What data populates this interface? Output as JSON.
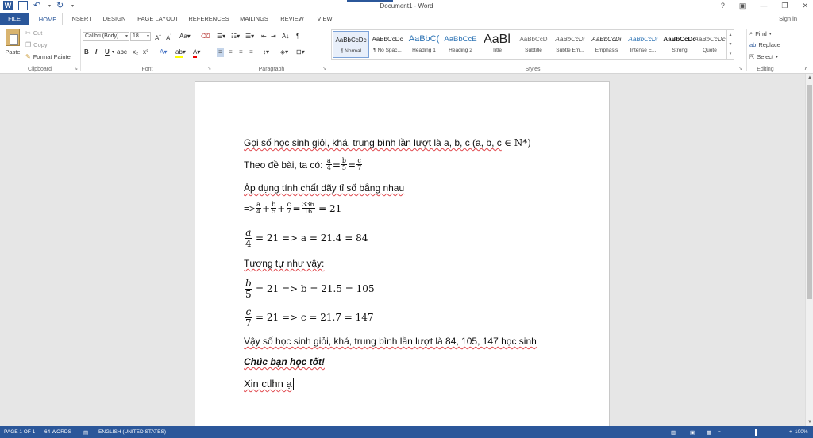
{
  "window": {
    "title": "Document1 - Word",
    "help": "?",
    "controls": [
      "▣",
      "—",
      "❐",
      "✕"
    ]
  },
  "tabs": [
    "FILE",
    "HOME",
    "INSERT",
    "DESIGN",
    "PAGE LAYOUT",
    "REFERENCES",
    "MAILINGS",
    "REVIEW",
    "VIEW"
  ],
  "signin": "Sign in",
  "ribbon": {
    "clipboard": {
      "label": "Clipboard",
      "paste": "Paste",
      "cut": "Cut",
      "copy": "Copy",
      "format_painter": "Format Painter"
    },
    "font": {
      "label": "Font",
      "name": "Calibri (Body)",
      "size": "18"
    },
    "paragraph": {
      "label": "Paragraph"
    },
    "styles": {
      "label": "Styles",
      "items": [
        {
          "preview": "AaBbCcDc",
          "name": "¶ Normal"
        },
        {
          "preview": "AaBbCcDc",
          "name": "¶ No Spac..."
        },
        {
          "preview": "AaBbC(",
          "name": "Heading 1"
        },
        {
          "preview": "AaBbCcE",
          "name": "Heading 2"
        },
        {
          "preview": "AaBl",
          "name": "Title"
        },
        {
          "preview": "AaBbCcD",
          "name": "Subtitle"
        },
        {
          "preview": "AaBbCcDi",
          "name": "Subtle Em..."
        },
        {
          "preview": "AaBbCcDi",
          "name": "Emphasis"
        },
        {
          "preview": "AaBbCcDi",
          "name": "Intense E..."
        },
        {
          "preview": "AaBbCcDc",
          "name": "Strong"
        },
        {
          "preview": "AaBbCcDc",
          "name": "Quote"
        }
      ]
    },
    "editing": {
      "label": "Editing",
      "find": "Find",
      "replace": "Replace",
      "select": "Select"
    }
  },
  "document": {
    "line1": {
      "text": "Gọi số học sinh giỏi, khá, trung bình lần lượt là a, b, c (a, b, c",
      "math": "∈ N*)"
    },
    "line2": {
      "text": "Theo đề bài, ta có:",
      "f1n": "a",
      "f1d": "4",
      "eq": "=",
      "f2n": "b",
      "f2d": "5",
      "f3n": "c",
      "f3d": "7"
    },
    "line3": "Áp dụng tính chất dãy tỉ số bằng nhau",
    "line4": {
      "prefix": "=>",
      "f1n": "a",
      "f1d": "4",
      "plus": "+",
      "f2n": "b",
      "f2d": "5",
      "f3n": "c",
      "f3d": "7",
      "eq": "=",
      "f4n": "336",
      "f4d": "16",
      "result": "= 21"
    },
    "line5": {
      "fn": "a",
      "fd": "4",
      "rest": "= 21 => a = 21.4 = 84"
    },
    "line6": "Tương tự như vậy:",
    "line7": {
      "fn": "b",
      "fd": "5",
      "rest": "= 21 => b = 21.5 = 105"
    },
    "line8": {
      "fn": "c",
      "fd": "7",
      "rest": "= 21 => c = 21.7 = 147"
    },
    "line9": "Vậy số học sinh giỏi, khá, trung bình lần lượt là 84, 105, 147 học sinh",
    "line10": "Chúc bạn học tốt!",
    "line11": "Xin ctlhn ạ"
  },
  "status": {
    "page": "PAGE 1 OF 1",
    "words": "64 WORDS",
    "language": "ENGLISH (UNITED STATES)",
    "zoom": "100%",
    "zoom_minus": "−",
    "zoom_plus": "+"
  }
}
